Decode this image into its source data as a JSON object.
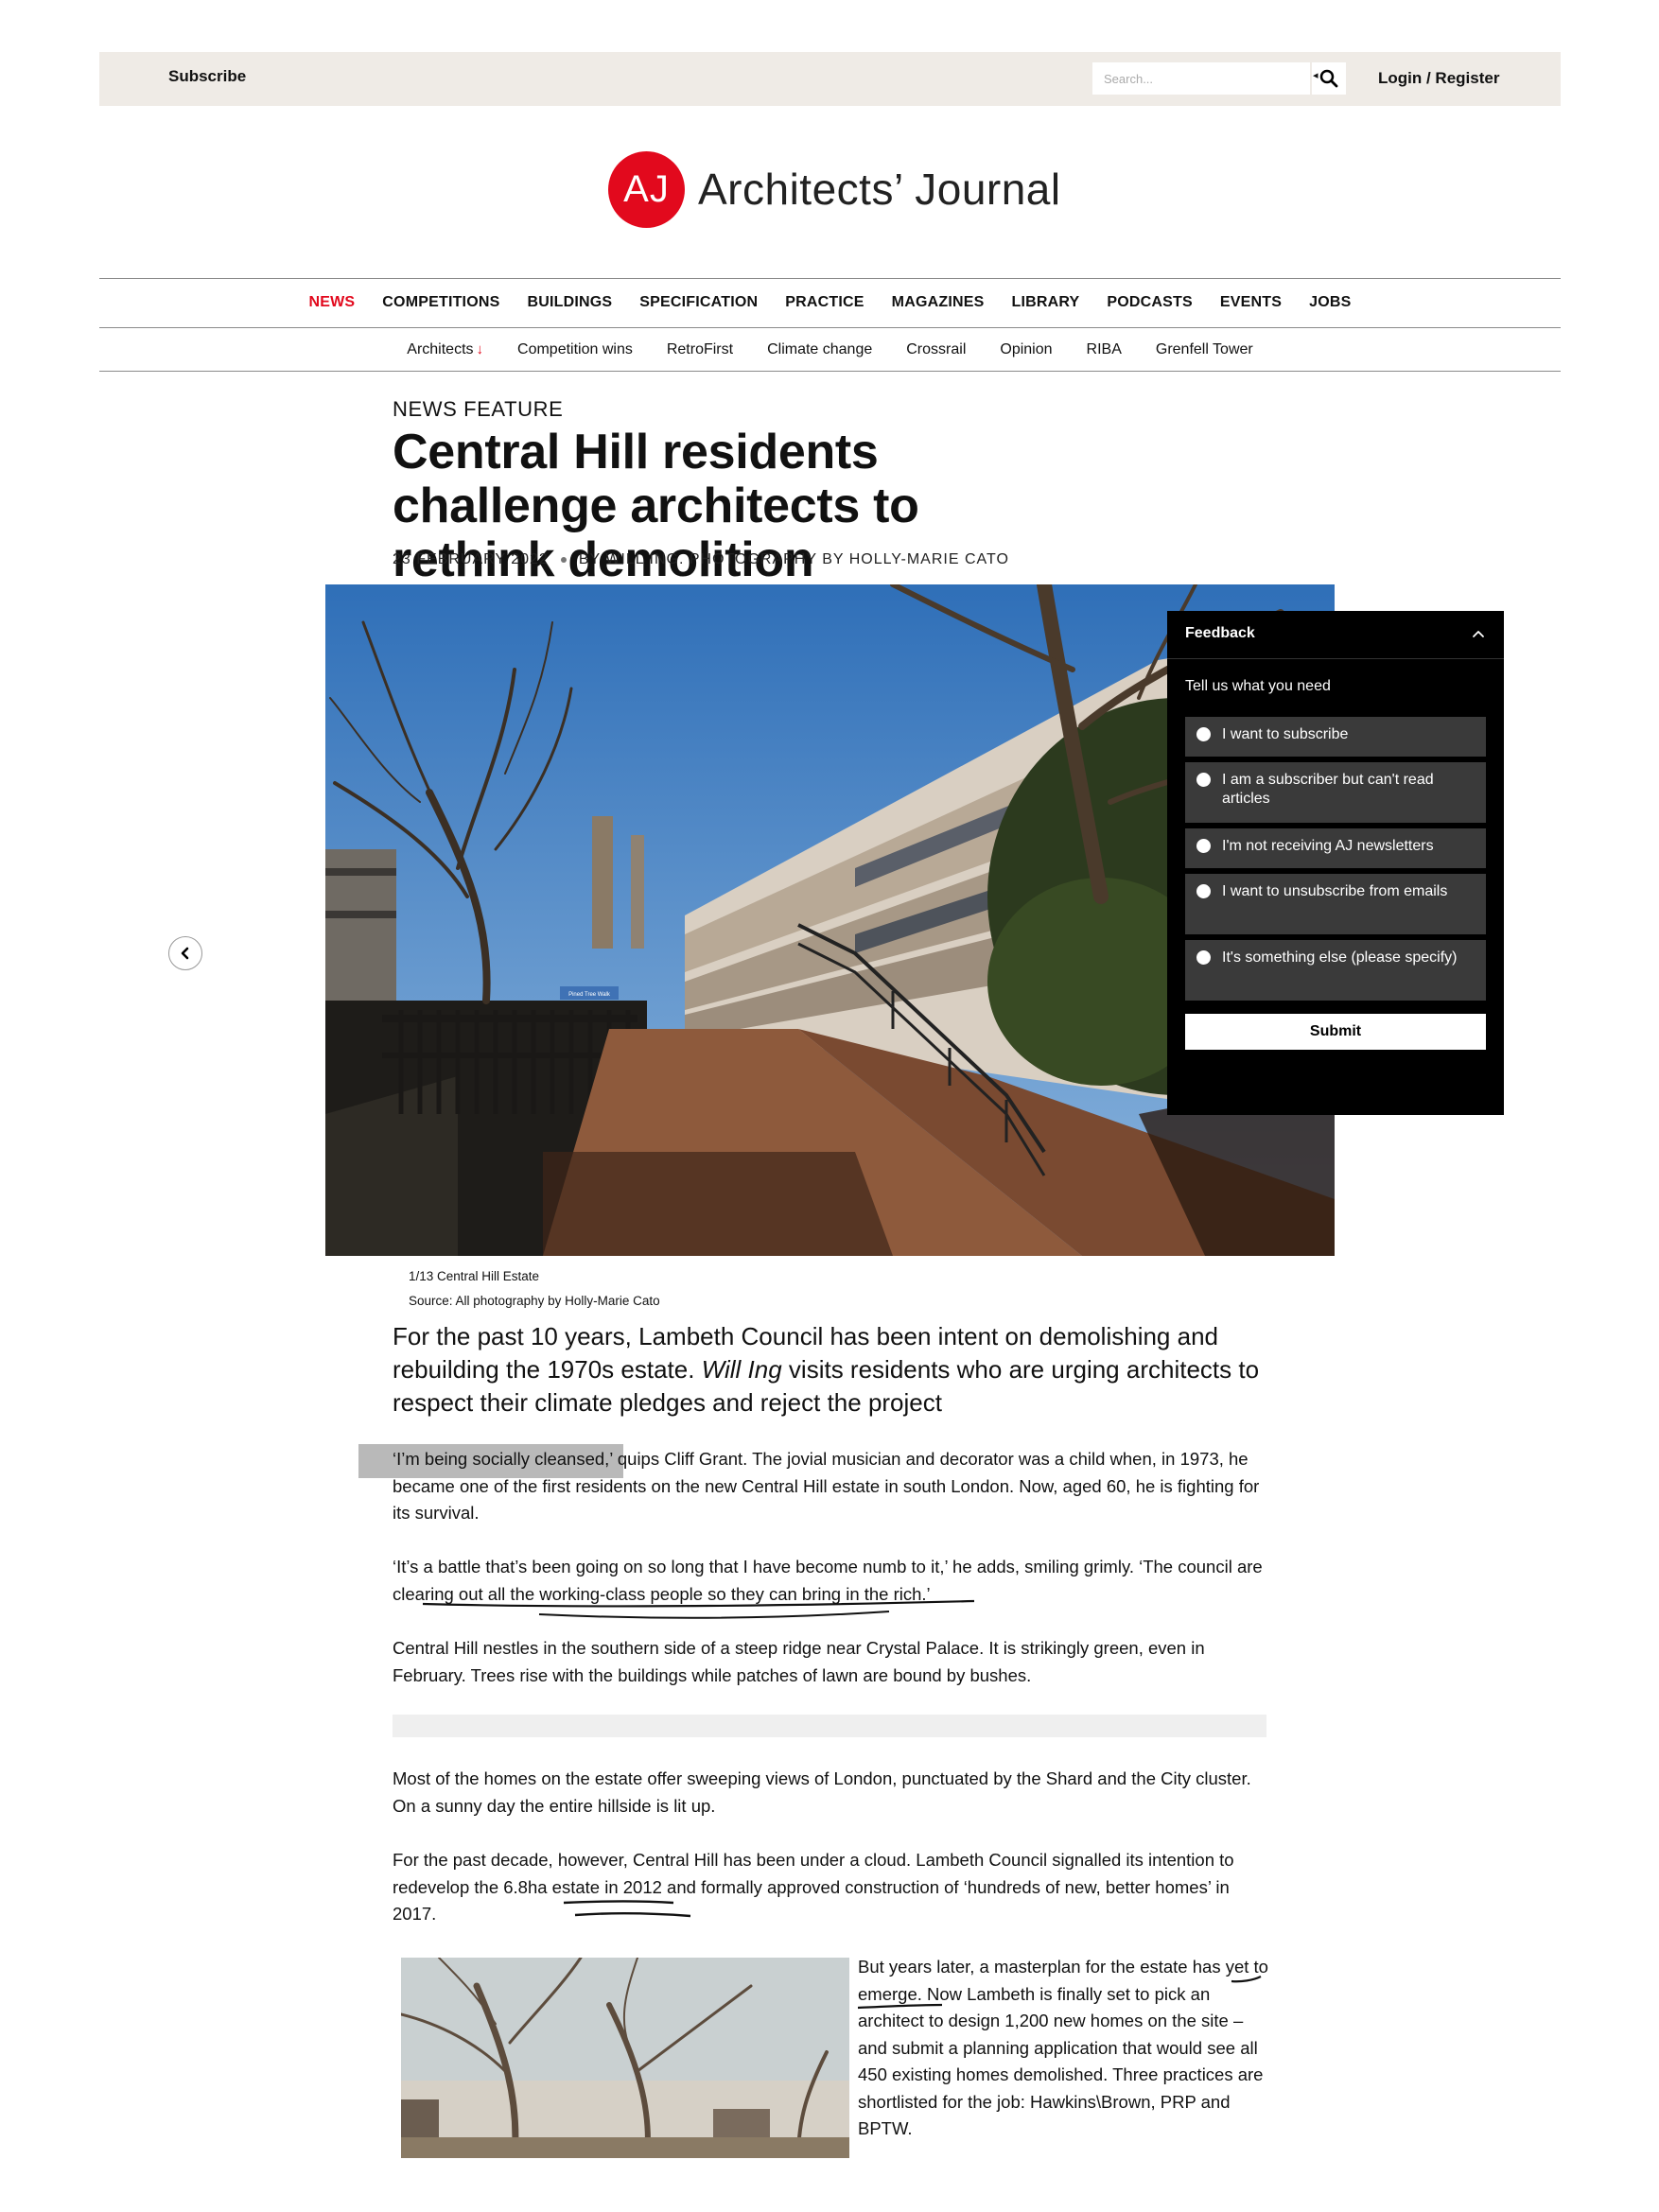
{
  "topbar": {
    "subscribe_label": "Subscribe",
    "search_placeholder": "Search...",
    "login_label": "Login / Register"
  },
  "logo": {
    "mark": "AJ",
    "name": "Architects’ Journal",
    "brand_color": "#e2091d"
  },
  "main_nav": [
    "NEWS",
    "COMPETITIONS",
    "BUILDINGS",
    "SPECIFICATION",
    "PRACTICE",
    "MAGAZINES",
    "LIBRARY",
    "PODCASTS",
    "EVENTS",
    "JOBS"
  ],
  "main_nav_active": "NEWS",
  "sub_nav": [
    "Architects",
    "Competition wins",
    "RetroFirst",
    "Climate change",
    "Crossrail",
    "Opinion",
    "RIBA",
    "Grenfell Tower"
  ],
  "sub_nav_first_arrow": "↓",
  "article": {
    "kicker": "NEWS FEATURE",
    "headline": "Central Hill residents challenge architects to rethink demolition",
    "date": "23 FEBRUARY 2022",
    "byline": "BY WILL ING. PHOTOGRAPHY BY HOLLY-MARIE CATO",
    "caption": "1/13 Central Hill Estate",
    "source": "Source: All photography by Holly-Marie Cato",
    "hero_sign_text": "Pined Tree Walk",
    "standfirst_pre": "For the past 10 years, Lambeth Council has been intent on demolishing and rebuilding the 1970s estate. ",
    "standfirst_author": "Will Ing",
    "standfirst_post": " visits residents who are urging architects to respect their climate pledges and reject the project",
    "p1_quote": "‘I’m being socially cleansed,’",
    "p1_rest": " quips Cliff Grant. The jovial musician and decorator was a child when, in 1973, he became one of the first residents on the new Central Hill estate in south London. Now, aged 60, he is fighting for its survival.",
    "p2": "‘It’s a battle that’s been going on so long that I have become numb to it,’ he adds, smiling grimly. ‘The council are clearing out all the working-class people so they can bring in the rich.’",
    "p3": "Central Hill nestles in the southern side of a steep ridge near Crystal Palace. It is strikingly green, even in February. Trees rise with the buildings while patches of lawn are bound by bushes.",
    "p4": "Most of the homes on the estate offer sweeping views of London, punctuated by the Shard and the City cluster. On a sunny day the entire hillside is lit up.",
    "p5": "For the past decade, however, Central Hill has been under a cloud. Lambeth Council signalled its intention to redevelop the 6.8ha estate in 2012 and formally approved construction of ‘hundreds of new, better homes’ in 2017.",
    "p6": "But years later, a masterplan for the estate has yet to emerge. Now Lambeth is finally set to pick an architect to design 1,200 new homes on the site – and submit a planning application that would see all 450 existing homes demolished. Three practices are shortlisted for the job: Hawkins\\Brown, PRP and BPTW."
  },
  "feedback": {
    "title": "Feedback",
    "prompt": "Tell us what you need",
    "options": [
      "I want to subscribe",
      "I am a subscriber but can't read articles",
      "I'm not receiving AJ newsletters",
      "I want to unsubscribe from emails",
      "It's something else (please specify)"
    ],
    "submit": "Submit"
  }
}
